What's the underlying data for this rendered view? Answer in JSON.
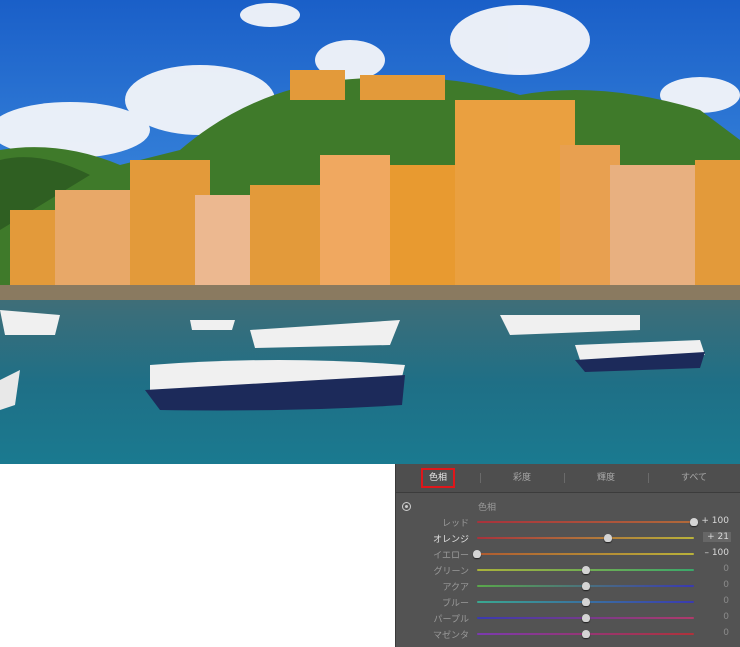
{
  "tabs": [
    {
      "label": "色相",
      "active": true
    },
    {
      "label": "彩度"
    },
    {
      "label": "輝度"
    },
    {
      "label": "すべて"
    }
  ],
  "section_title": "色相",
  "sliders": [
    {
      "label": "レッド",
      "value": 100,
      "display": "+ 100",
      "colors": [
        "#a8323c",
        "#b06a3a"
      ]
    },
    {
      "label": "オレンジ",
      "value": 21,
      "display": "+ 21",
      "highlight": true,
      "colors": [
        "#a8323c",
        "#b9b23a"
      ]
    },
    {
      "label": "イエロー",
      "value": -100,
      "display": "– 100",
      "colors": [
        "#b05a30",
        "#b9b23a"
      ]
    },
    {
      "label": "グリーン",
      "value": 0,
      "display": "0",
      "colors": [
        "#aab23a",
        "#3aa86a"
      ]
    },
    {
      "label": "アクア",
      "value": 0,
      "display": "0",
      "colors": [
        "#5aa84a",
        "#3a3ab0"
      ]
    },
    {
      "label": "ブルー",
      "value": 0,
      "display": "0",
      "colors": [
        "#3aa890",
        "#3a3ab0"
      ]
    },
    {
      "label": "パープル",
      "value": 0,
      "display": "0",
      "colors": [
        "#3a3ab0",
        "#b03a6a"
      ]
    },
    {
      "label": "マゼンタ",
      "value": 0,
      "display": "0",
      "colors": [
        "#7a3ab0",
        "#b0323a"
      ]
    }
  ]
}
